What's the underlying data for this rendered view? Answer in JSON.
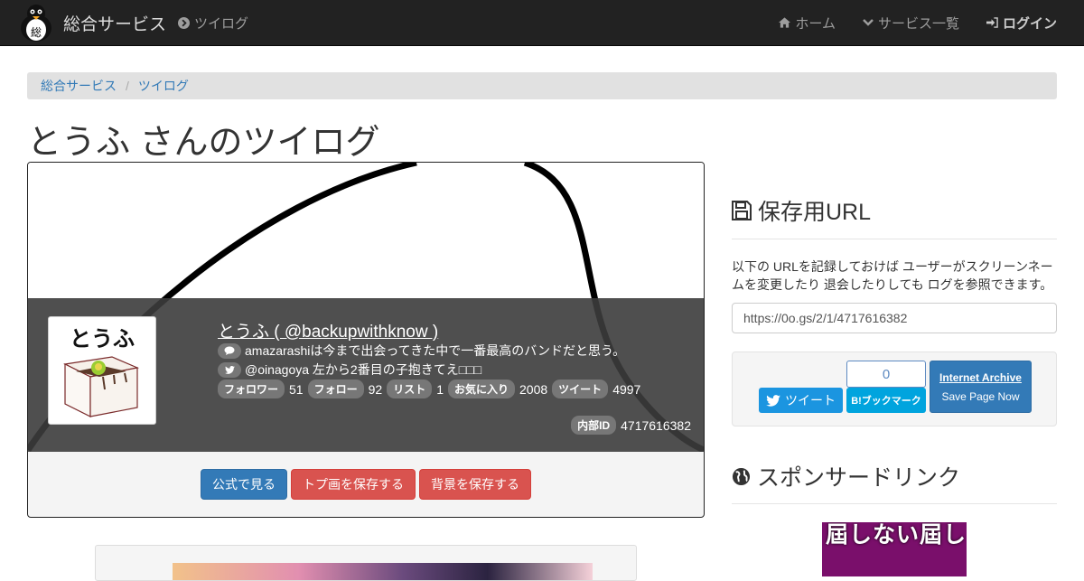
{
  "navbar": {
    "brand": "総合サービス",
    "left_item": "ツイログ",
    "right_items": [
      "ホーム",
      "サービス一覧",
      "ログイン"
    ]
  },
  "breadcrumb": [
    "総合サービス",
    "ツイログ"
  ],
  "page_title": "とうふ さんのツイログ",
  "profile": {
    "avatar_text": "とうふ",
    "name_line": "とうふ ( @backupwithknow )",
    "bio": "amazarashiは今まで出会ってきた中で一番最高のバンドだと思う。",
    "tweet_line": "@oinagoya 左から2番目の子抱きてえ□□□",
    "stats": [
      {
        "label": "フォロワー",
        "value": "51"
      },
      {
        "label": "フォロー",
        "value": "92"
      },
      {
        "label": "リスト",
        "value": "1"
      },
      {
        "label": "お気に入り",
        "value": "2008"
      },
      {
        "label": "ツイート",
        "value": "4997"
      }
    ],
    "id_label": "内部ID",
    "id_value": "4717616382"
  },
  "buttons": {
    "official": "公式で見る",
    "save_top": "トプ画を保存する",
    "save_bg": "背景を保存する"
  },
  "sidebar": {
    "save_heading": "保存用URL",
    "save_desc": "以下の URLを記録しておけば ユーザーがスクリーンネームを変更したり 退会したりしても ログを参照できます。",
    "url_value": "https://0o.gs/2/1/4717616382",
    "tweet_btn": "ツイート",
    "hatena_count": "0",
    "hatena_btn": "B!ブックマーク",
    "ia_title": "Internet Archive",
    "ia_sub": "Save Page Now",
    "sponsor_heading": "スポンサードリンク",
    "sponsor_text": "屆しない屆し"
  },
  "colors": {
    "navbar": "#222222",
    "primary": "#337ab7",
    "danger": "#d9534f",
    "twitter": "#1b95e0",
    "hatena": "#00a4de"
  }
}
